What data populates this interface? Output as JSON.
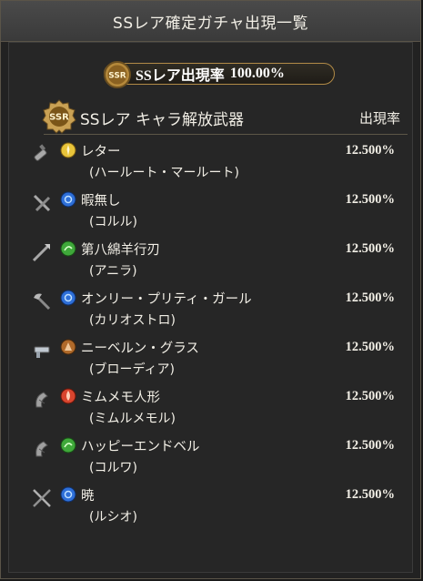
{
  "header": {
    "title": "SSレア確定ガチャ出現一覧"
  },
  "summary": {
    "emblem_text": "SSR",
    "label": "SSレア出現率",
    "rate": "100.00%"
  },
  "section": {
    "badge_text": "SSR",
    "title": "SSレア キャラ解放武器",
    "rate_column": "出現率"
  },
  "items": [
    {
      "name": "レター",
      "character": "(ハールート・マールート)",
      "rate": "12.500%",
      "element": "light",
      "weapon": "dagger-icon"
    },
    {
      "name": "暇無し",
      "character": "(コルル)",
      "rate": "12.500%",
      "element": "water",
      "weapon": "dual-blades-icon"
    },
    {
      "name": "第八綿羊行刃",
      "character": "(アニラ)",
      "rate": "12.500%",
      "element": "wind",
      "weapon": "spear-icon"
    },
    {
      "name": "オンリー・プリティ・ガール",
      "character": "(カリオストロ)",
      "rate": "12.500%",
      "element": "water",
      "weapon": "axe-icon"
    },
    {
      "name": "ニーベルン・グラス",
      "character": "(ブローディア)",
      "rate": "12.500%",
      "element": "earth",
      "weapon": "gun-icon"
    },
    {
      "name": "ミムメモ人形",
      "character": "(ミムルメモル)",
      "rate": "12.500%",
      "element": "fire",
      "weapon": "harp-icon"
    },
    {
      "name": "ハッピーエンドベル",
      "character": "(コルワ)",
      "rate": "12.500%",
      "element": "wind",
      "weapon": "harp-icon"
    },
    {
      "name": "暁",
      "character": "(ルシオ)",
      "rate": "12.500%",
      "element": "water",
      "weapon": "sword-icon"
    }
  ],
  "colors": {
    "light": "#e8c43a",
    "water": "#2e6fd8",
    "wind": "#3fa83a",
    "earth": "#b06a2a",
    "fire": "#d8452e",
    "gold": "#c9a154"
  }
}
